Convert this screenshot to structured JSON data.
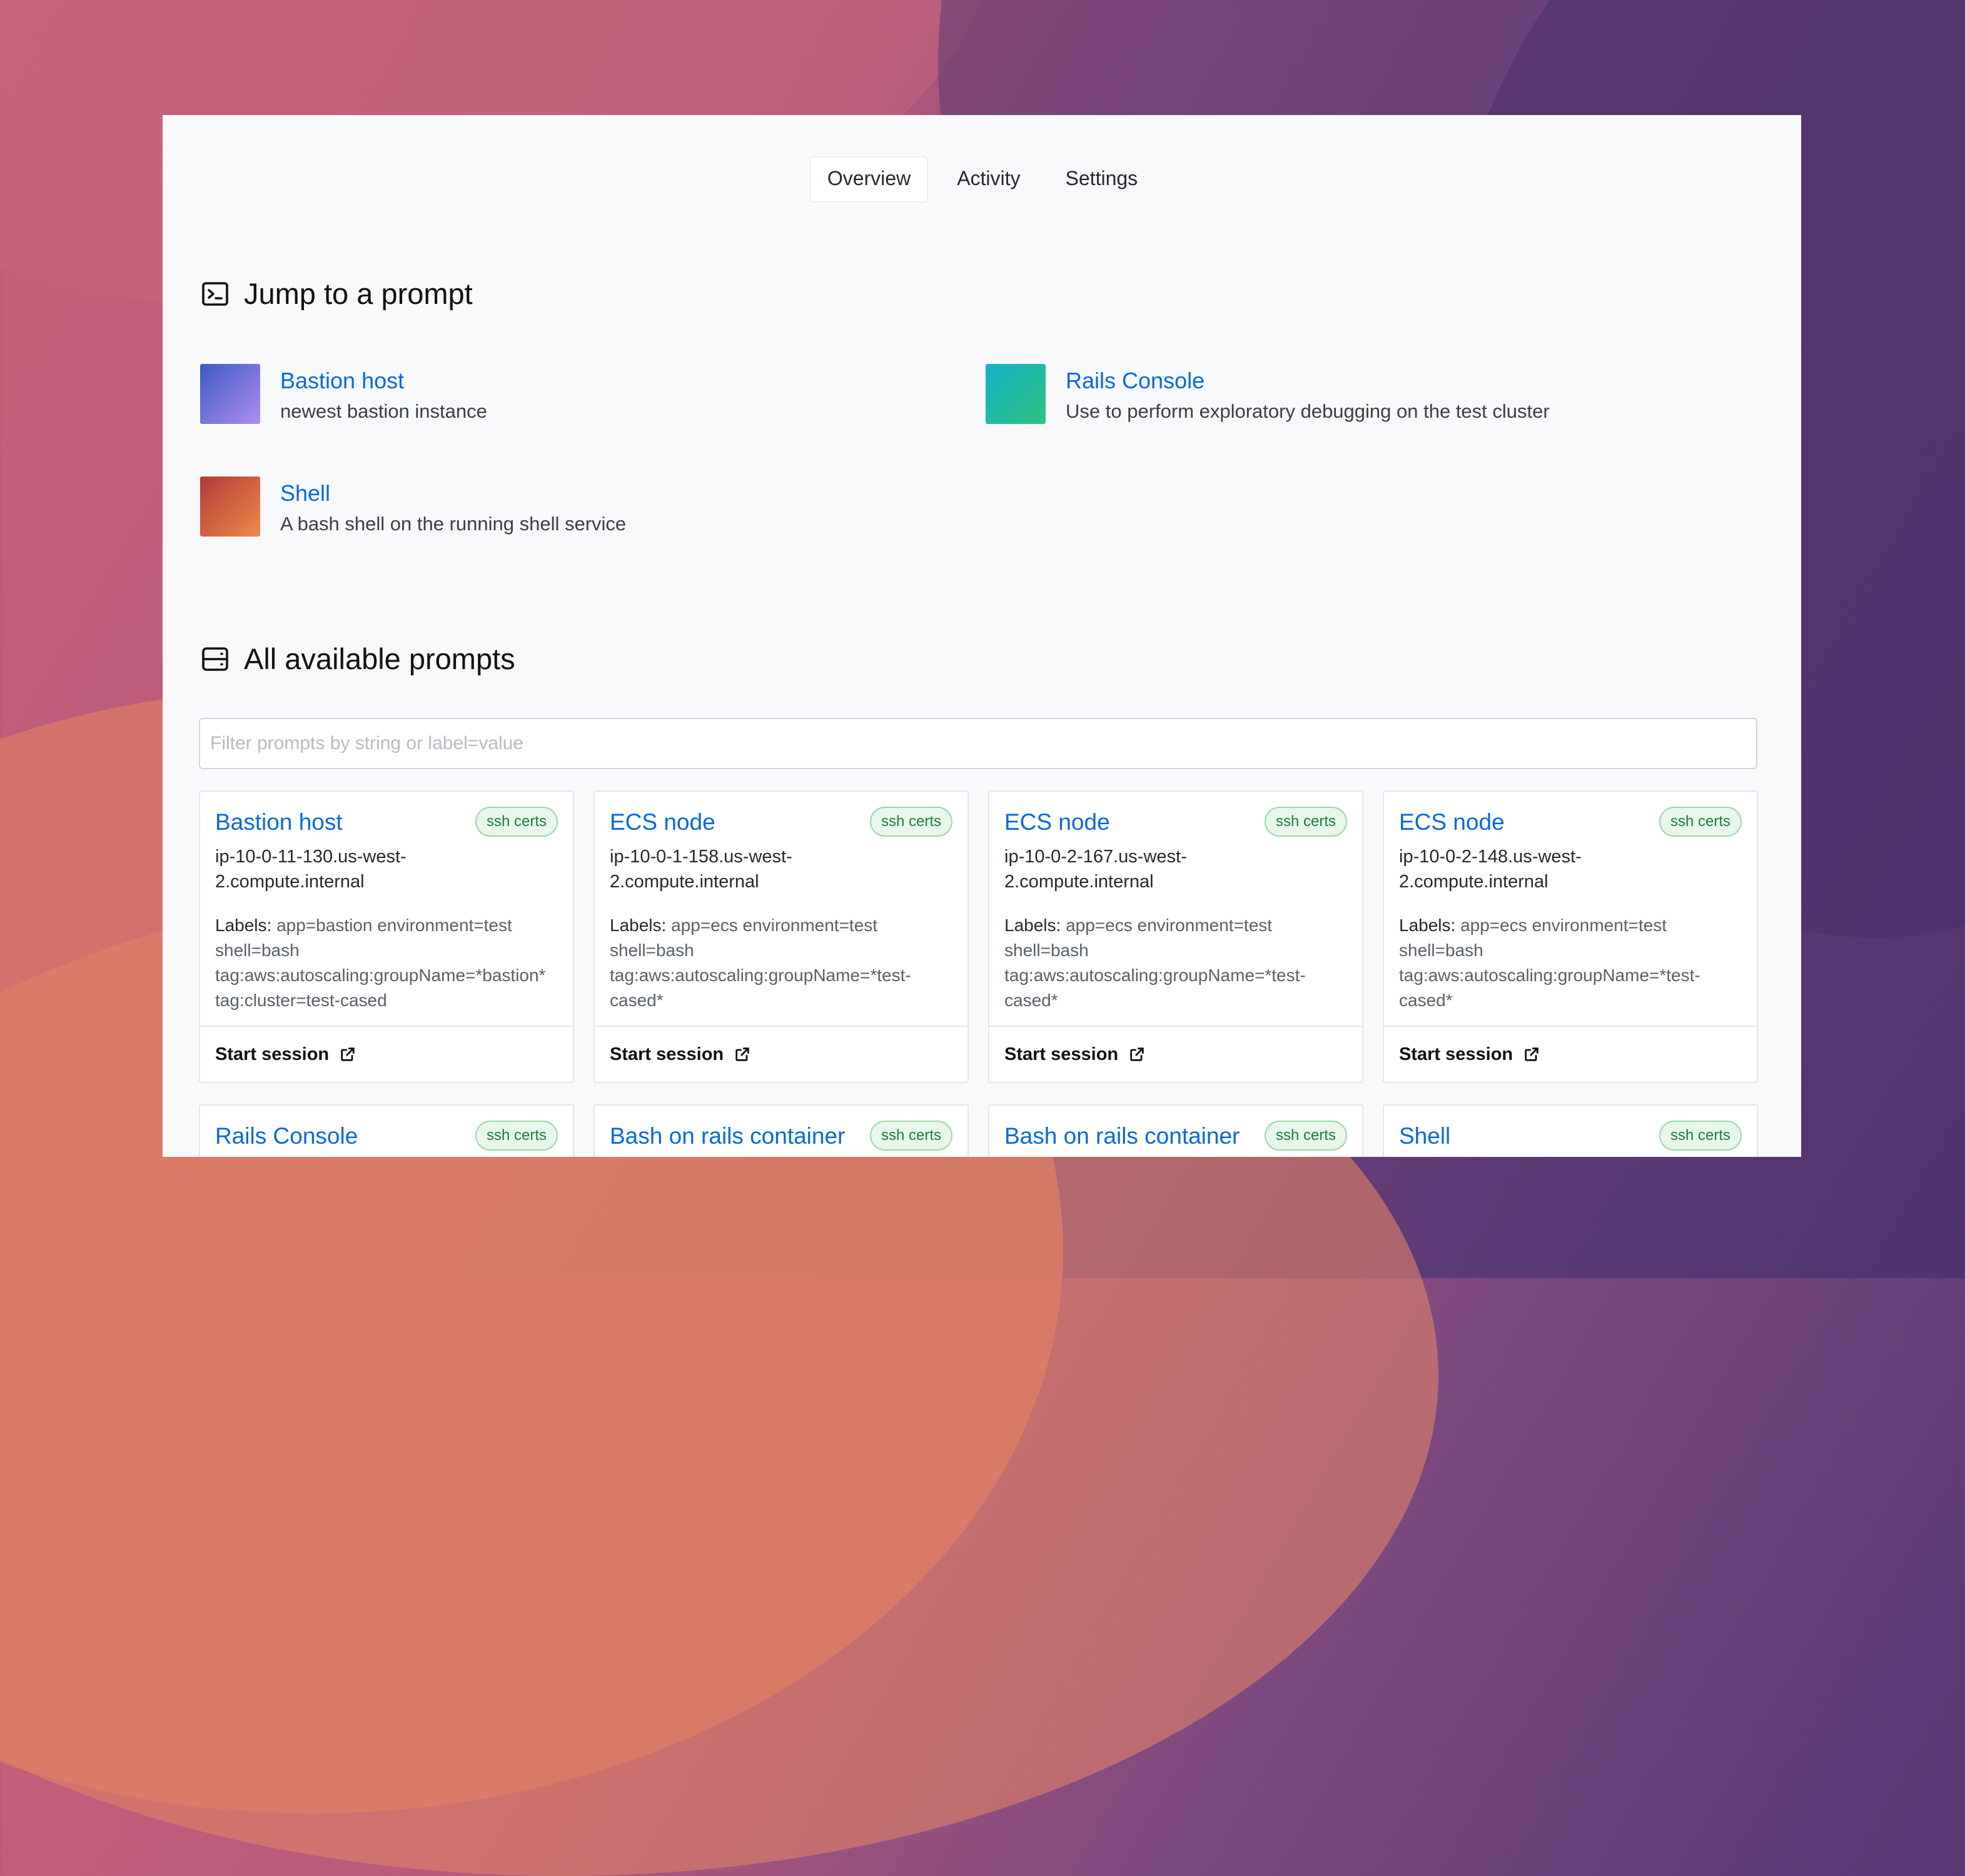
{
  "tabs": [
    {
      "label": "Overview",
      "active": true
    },
    {
      "label": "Activity",
      "active": false
    },
    {
      "label": "Settings",
      "active": false
    }
  ],
  "jump_section": {
    "title": "Jump to a prompt",
    "items": [
      {
        "name": "Bastion host",
        "description": "newest bastion instance",
        "color_from": "#3b5bc4",
        "color_to": "#b18ef0"
      },
      {
        "name": "Rails Console",
        "description": "Use to perform exploratory debugging on the test cluster",
        "color_from": "#14b3c9",
        "color_to": "#2ec27e"
      },
      {
        "name": "Shell",
        "description": "A bash shell on the running shell service",
        "color_from": "#b03a3a",
        "color_to": "#f08a4b"
      }
    ]
  },
  "all_section": {
    "title": "All available prompts",
    "filter_placeholder": "Filter prompts by string or label=value"
  },
  "cards": [
    {
      "title": "Bastion host",
      "badge": "ssh certs",
      "host_line1": "ip-10-0-11-130.us-west-",
      "host_line2": "2.compute.internal",
      "labels_key": "Labels:",
      "labels_line1": " app=bastion environment=test",
      "labels_line2": "shell=bash",
      "labels_line3": "tag:aws:autoscaling:groupName=*bastion*",
      "labels_line4": "tag:cluster=test-cased",
      "action": "Start session"
    },
    {
      "title": "ECS node",
      "badge": "ssh certs",
      "host_line1": "ip-10-0-1-158.us-west-",
      "host_line2": "2.compute.internal",
      "labels_key": "Labels:",
      "labels_line1": " app=ecs environment=test",
      "labels_line2": "shell=bash",
      "labels_line3": "tag:aws:autoscaling:groupName=*test-",
      "labels_line4": "cased*",
      "action": "Start session"
    },
    {
      "title": "ECS node",
      "badge": "ssh certs",
      "host_line1": "ip-10-0-2-167.us-west-",
      "host_line2": "2.compute.internal",
      "labels_key": "Labels:",
      "labels_line1": " app=ecs environment=test",
      "labels_line2": "shell=bash",
      "labels_line3": "tag:aws:autoscaling:groupName=*test-",
      "labels_line4": "cased*",
      "action": "Start session"
    },
    {
      "title": "ECS node",
      "badge": "ssh certs",
      "host_line1": "ip-10-0-2-148.us-west-",
      "host_line2": "2.compute.internal",
      "labels_key": "Labels:",
      "labels_line1": " app=ecs environment=test",
      "labels_line2": "shell=bash",
      "labels_line3": "tag:aws:autoscaling:groupName=*test-",
      "labels_line4": "cased*",
      "action": "Start session"
    }
  ],
  "cards_row2": [
    {
      "title": "Rails Console",
      "badge": "ssh certs"
    },
    {
      "title": "Bash on rails container",
      "badge": "ssh certs"
    },
    {
      "title": "Bash on rails container",
      "badge": "ssh certs"
    },
    {
      "title": "Shell",
      "badge": "ssh certs"
    }
  ],
  "colors": {
    "link": "#0969da",
    "badge_text": "#1a7f37",
    "badge_bg": "#e8f6ec"
  }
}
